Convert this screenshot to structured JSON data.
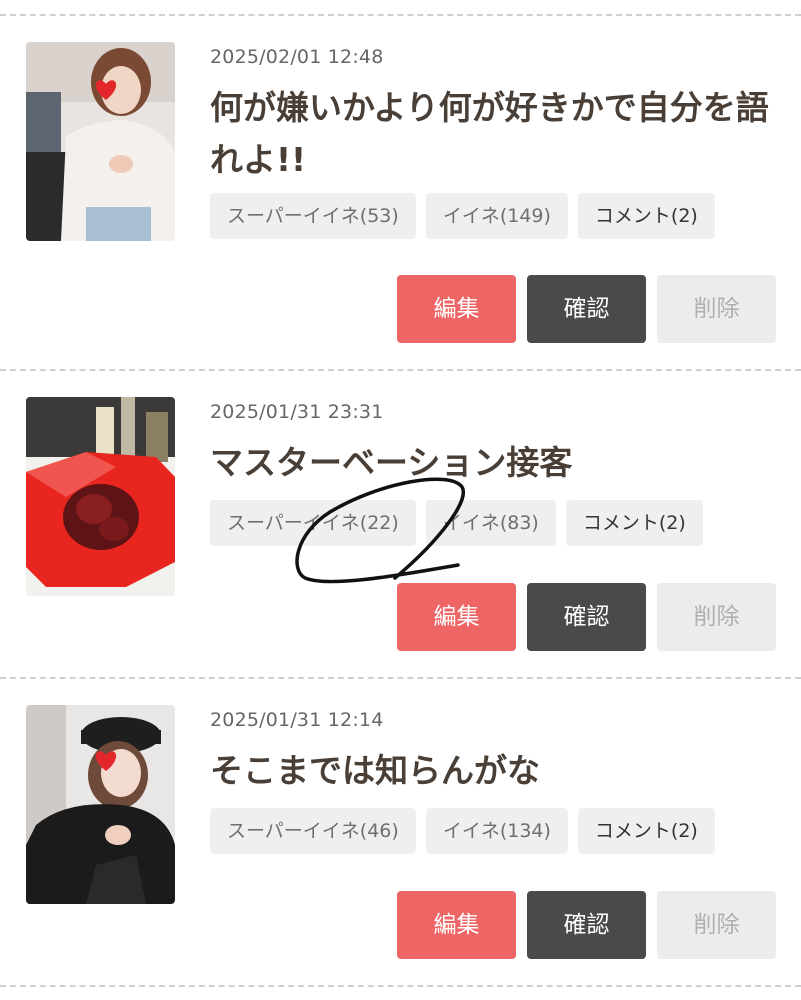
{
  "posts": [
    {
      "date": "2025/02/01 12:48",
      "title": "何が嫌いかより何が好きかで自分を語れよ!!",
      "tags": {
        "super_like": "スーパーイイネ(53)",
        "like": "イイネ(149)",
        "comment": "コメント(2)"
      },
      "buttons": {
        "edit": "編集",
        "confirm": "確認",
        "delete": "削除"
      }
    },
    {
      "date": "2025/01/31 23:31",
      "title": "マスターベーション接客",
      "tags": {
        "super_like": "スーパーイイネ(22)",
        "like": "イイネ(83)",
        "comment": "コメント(2)"
      },
      "buttons": {
        "edit": "編集",
        "confirm": "確認",
        "delete": "削除"
      }
    },
    {
      "date": "2025/01/31 12:14",
      "title": "そこまでは知らんがな",
      "tags": {
        "super_like": "スーパーイイネ(46)",
        "like": "イイネ(134)",
        "comment": "コメント(2)"
      },
      "buttons": {
        "edit": "編集",
        "confirm": "確認",
        "delete": "削除"
      }
    }
  ],
  "colors": {
    "edit": "#ee6565",
    "confirm": "#4a4a4a",
    "delete": "#ececec",
    "tag_bg": "#efefef",
    "title": "#4a3f36"
  }
}
